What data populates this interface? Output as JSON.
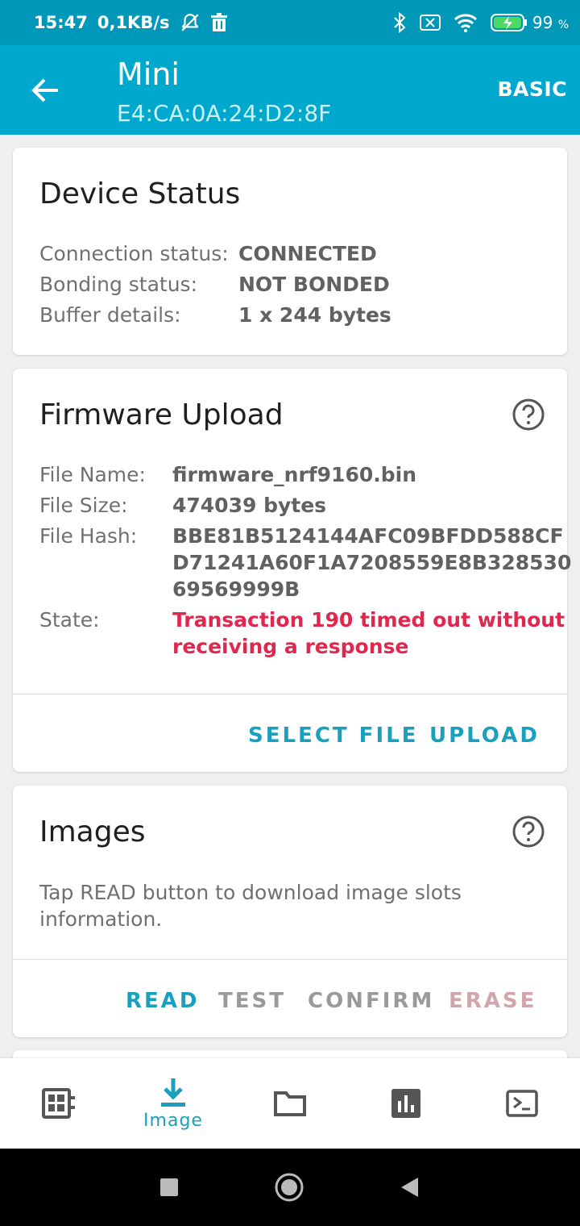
{
  "status_bar": {
    "time": "15:47",
    "net_speed": "0,1KB/s",
    "battery": "99",
    "battery_unit": "%",
    "icons": [
      "alarm-off-icon",
      "trash-icon",
      "bluetooth-icon",
      "sim-off-icon",
      "wifi-icon",
      "battery-charging-icon"
    ]
  },
  "app_bar": {
    "title": "Mini",
    "subtitle": "E4:CA:0A:24:D2:8F",
    "mode_button": "BASIC"
  },
  "device_status": {
    "title": "Device Status",
    "rows": [
      {
        "label": "Connection status:",
        "value": "CONNECTED"
      },
      {
        "label": "Bonding status:",
        "value": "NOT BONDED"
      },
      {
        "label": "Buffer details:",
        "value": "1 x 244 bytes"
      }
    ]
  },
  "firmware_upload": {
    "title": "Firmware Upload",
    "file_name_label": "File Name:",
    "file_name": "firmware_nrf9160.bin",
    "file_size_label": "File Size:",
    "file_size": "474039 bytes",
    "file_hash_label": "File Hash:",
    "file_hash_lines": [
      "BBE81B5124144AFC09BFDD588CF",
      "D71241A60F1A7208559E8B328530",
      "69569999B"
    ],
    "state_label": "State:",
    "state_lines": [
      "Transaction 190 timed out without",
      "receiving a response"
    ],
    "select_file": "SELECT FILE",
    "upload": "UPLOAD"
  },
  "images": {
    "title": "Images",
    "description_lines": [
      "Tap READ button to download image slots",
      "information."
    ],
    "read": "READ",
    "test": "TEST",
    "confirm": "CONFIRM",
    "erase": "ERASE"
  },
  "bottom_nav": {
    "active_label": "Image",
    "items": [
      "device-icon",
      "image-download-icon",
      "folder-icon",
      "stats-icon",
      "terminal-icon"
    ]
  },
  "colors": {
    "status_bar": "#0098b8",
    "app_bar": "#00a8ce",
    "accent": "#1a9fbe",
    "error": "#e0284f"
  }
}
